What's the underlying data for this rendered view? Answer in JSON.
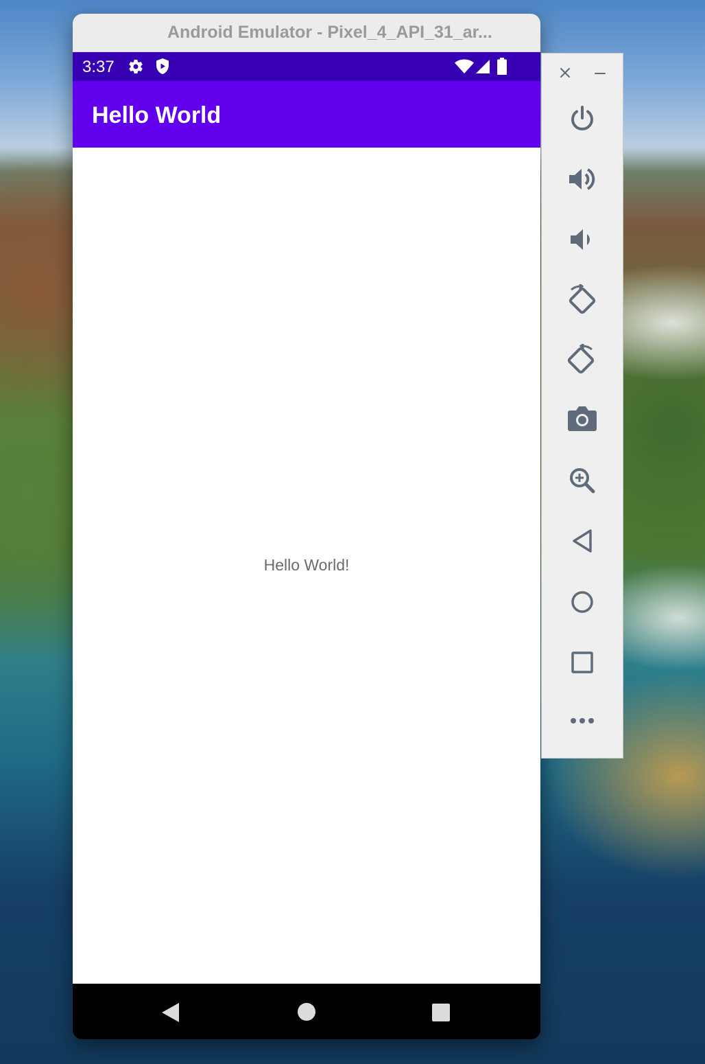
{
  "window": {
    "title": "Android Emulator - Pixel_4_API_31_ar..."
  },
  "status_bar": {
    "time": "3:37",
    "icons": [
      "settings-icon",
      "shield-icon",
      "wifi-icon",
      "signal-icon",
      "battery-icon"
    ]
  },
  "app_bar": {
    "title": "Hello World"
  },
  "content": {
    "message": "Hello World!"
  },
  "nav_bar": {
    "buttons": [
      "back",
      "home",
      "overview"
    ]
  },
  "toolbar": {
    "buttons": [
      "close",
      "minimize",
      "power",
      "volume-up",
      "volume-down",
      "rotate-left",
      "rotate-right",
      "take-screenshot",
      "zoom",
      "back",
      "home",
      "overview",
      "more"
    ]
  },
  "colors": {
    "status_bar": "#3700b3",
    "app_bar": "#6200ee",
    "content_background": "#ffffff",
    "toolbar_icon": "#5f6b7a"
  }
}
